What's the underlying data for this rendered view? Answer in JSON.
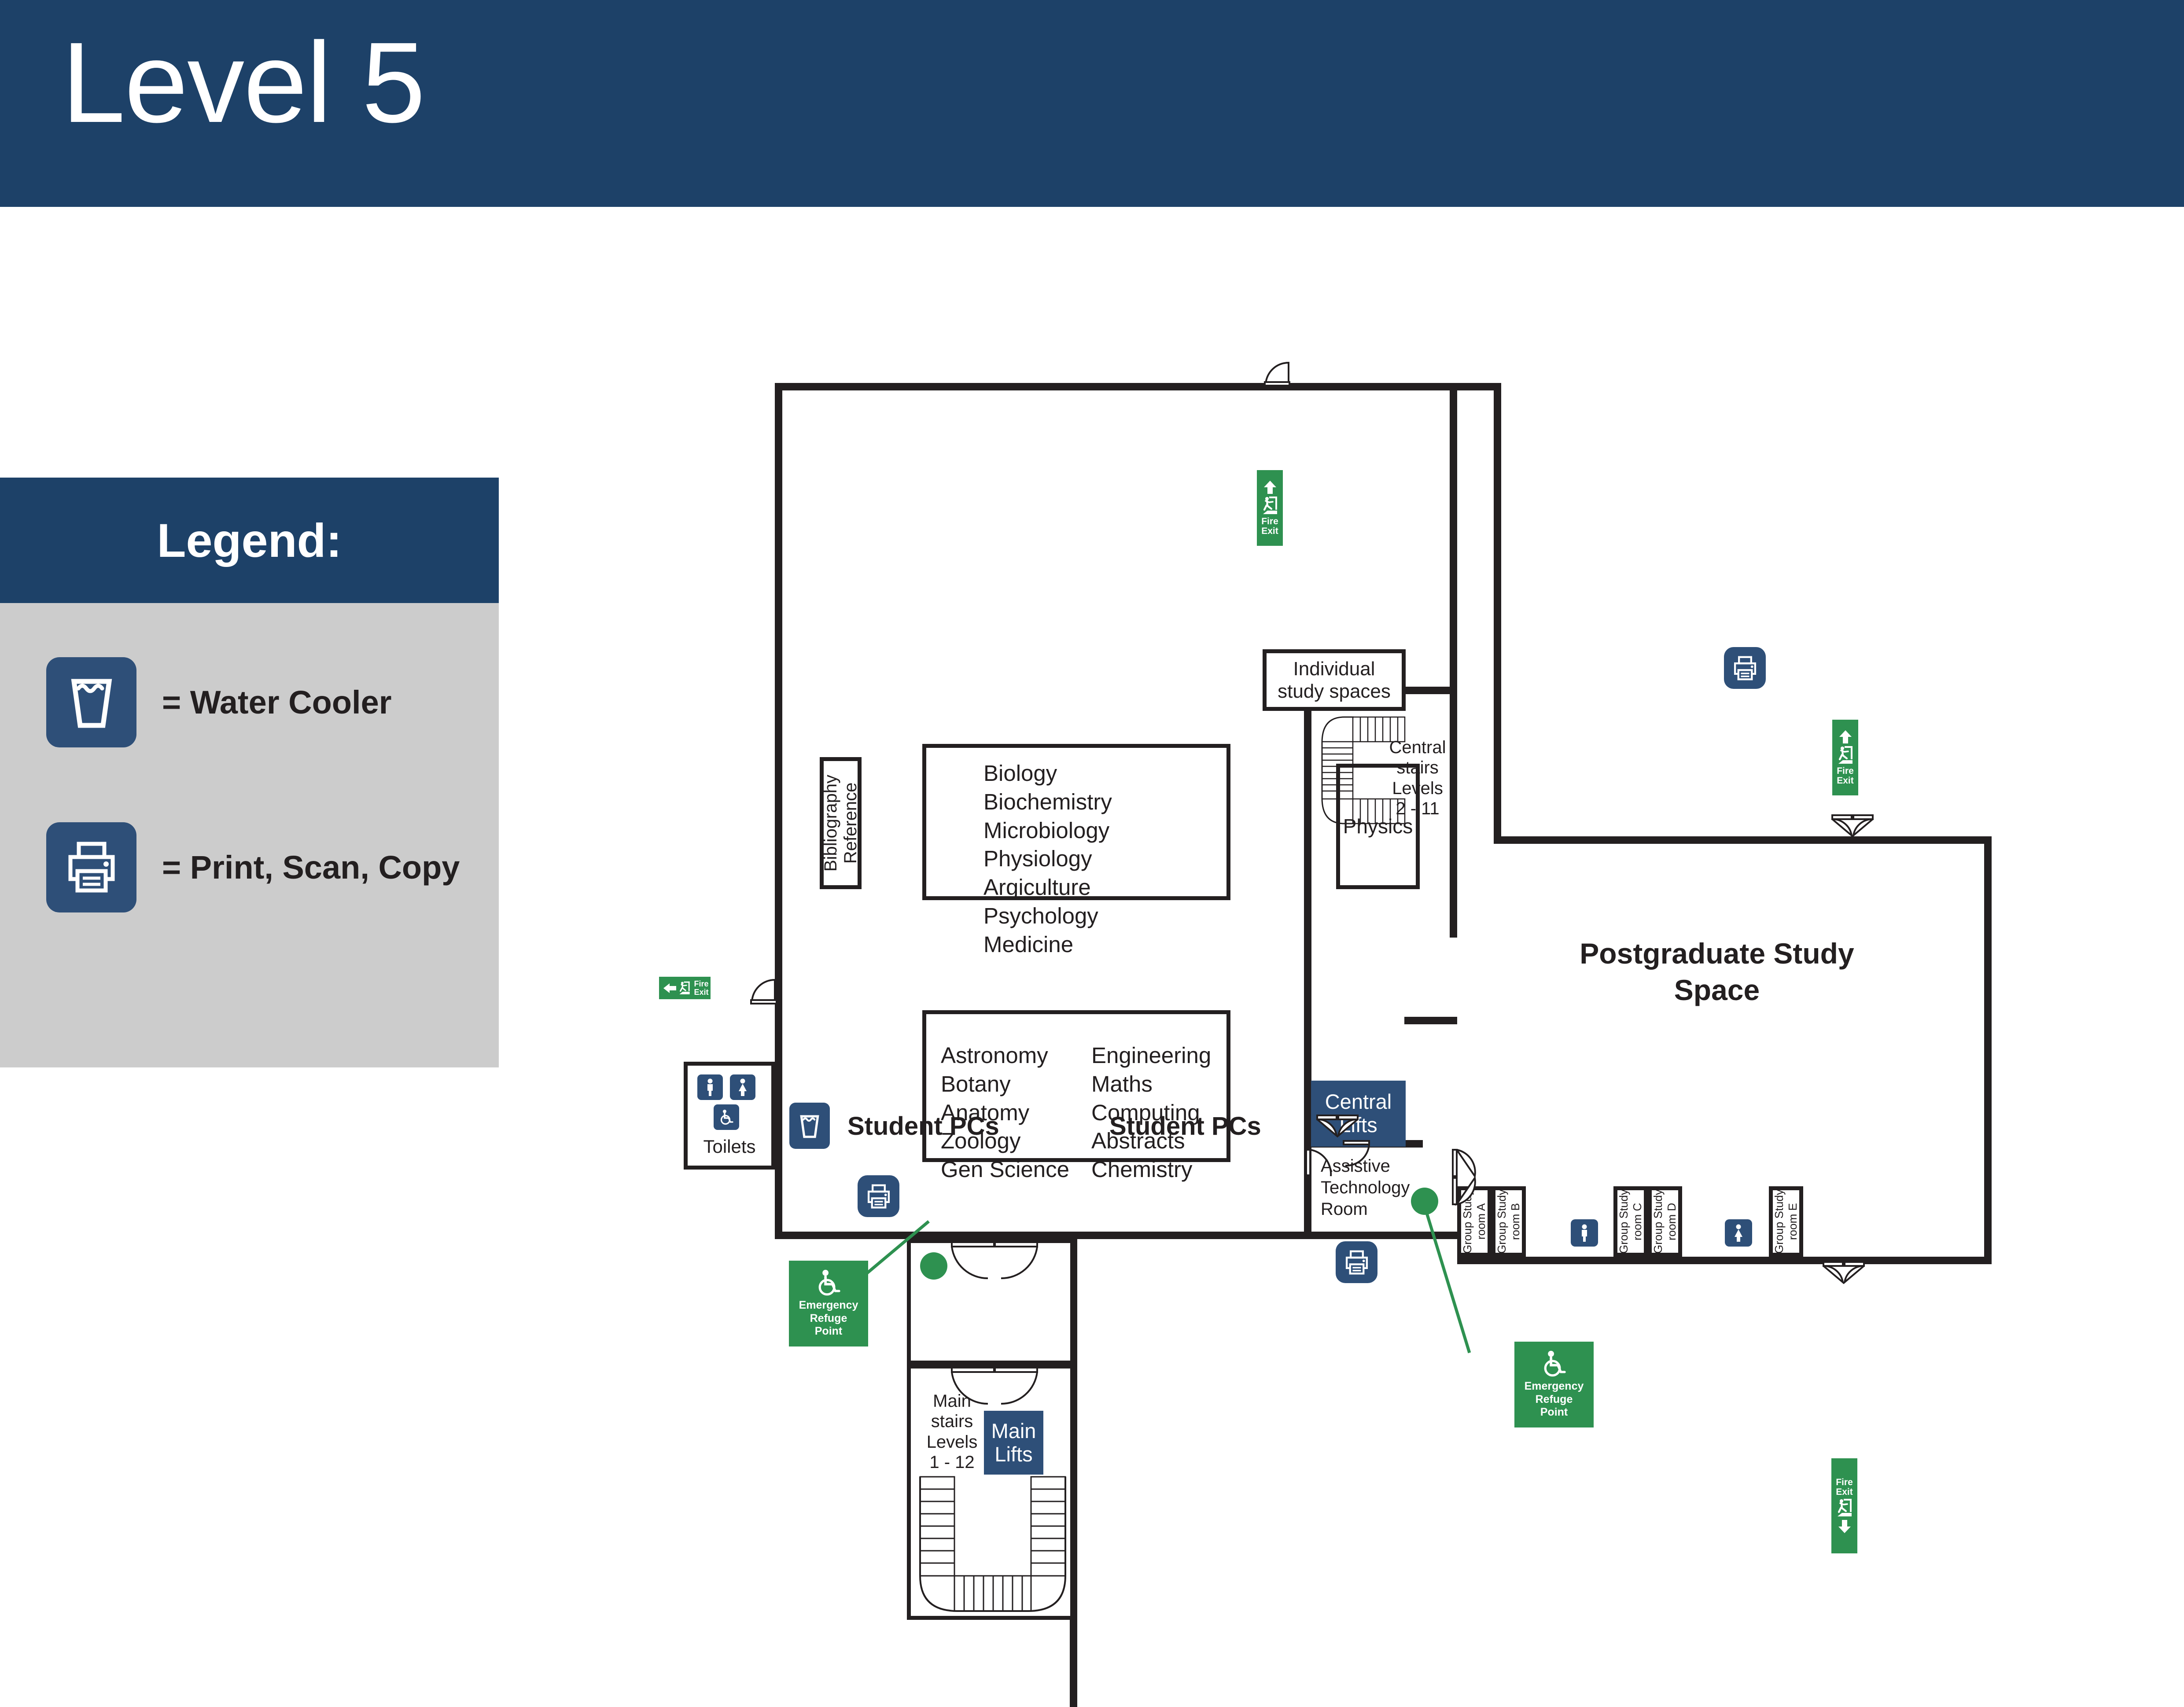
{
  "header": {
    "title": "Level 5",
    "bg_color": "#1d4168"
  },
  "legend": {
    "title": "Legend:",
    "head_bg": "#1d4168",
    "body_bg": "#cccccc",
    "items": [
      {
        "icon": "water-cooler-icon",
        "label": "= Water Cooler"
      },
      {
        "icon": "printer-icon",
        "label": "= Print, Scan, Copy"
      }
    ]
  },
  "colors": {
    "navy": "#1d4168",
    "icon_navy": "#2e4f78",
    "green": "#2e9150",
    "wall": "#231f20"
  },
  "floorplan": {
    "rooms": {
      "bibliography": {
        "lines": [
          "Bibliography",
          "Reference"
        ]
      },
      "subjects_upper": [
        "Biology",
        "Biochemistry",
        "Microbiology",
        "Physiology",
        "Argiculture",
        "Psychology",
        "Medicine"
      ],
      "subjects_lower_col1": [
        "Astronomy",
        "Botany",
        "Anatomy",
        "Zoology",
        "Gen Science"
      ],
      "subjects_lower_col2": [
        "Engineering",
        "Maths",
        "Computing",
        "Abstracts",
        "Chemistry"
      ],
      "individual_study": [
        "Individual",
        "study spaces"
      ],
      "physics": "Physics",
      "central_stairs": [
        "Central",
        "stairs",
        "Levels",
        "2 - 11"
      ],
      "central_lifts": [
        "Central",
        "Lifts"
      ],
      "main_stairs": [
        "Main",
        "stairs",
        "Levels",
        "1 - 12"
      ],
      "main_lifts": [
        "Main",
        "Lifts"
      ],
      "postgraduate": [
        "Postgraduate Study",
        "Space"
      ],
      "assistive": [
        "Assistive",
        "Technology",
        "Room"
      ],
      "toilets": "Toilets",
      "student_pcs_left": "Student PCs",
      "student_pcs_right": "Student PCs",
      "group_study_rooms": [
        {
          "lines": [
            "Group Study",
            "room A"
          ]
        },
        {
          "lines": [
            "Group Study",
            "room B"
          ]
        },
        {
          "lines": [
            "Group Study",
            "room C"
          ]
        },
        {
          "lines": [
            "Group Study",
            "room D"
          ]
        },
        {
          "lines": [
            "Group Study",
            "room E"
          ]
        }
      ]
    },
    "signs": {
      "fire_exit_label": [
        "Fire",
        "Exit"
      ],
      "emergency_refuge": [
        "Emergency",
        "Refuge",
        "Point"
      ],
      "fire_exit_top": {
        "direction": "up"
      },
      "fire_exit_right": {
        "direction": "up"
      },
      "fire_exit_left": {
        "direction": "left"
      },
      "fire_exit_bottom_right": {
        "direction": "down"
      }
    }
  }
}
